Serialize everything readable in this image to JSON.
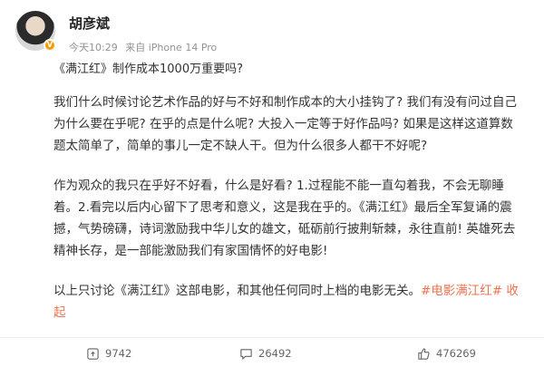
{
  "post": {
    "username": "胡彦斌",
    "time": "今天10:29",
    "source": "来自 iPhone 14 Pro",
    "title": "《满江红》制作成本1000万重要吗?",
    "paragraphs": [
      "我们什么时候讨论艺术作品的好与不好和制作成本的大小挂钩了? 我们有没有问过自己为什么要在乎呢? 在乎的点是什么呢? 大投入一定等于好作品吗? 如果是这样这道算数题太简单了，简单的事儿一定不缺人干。但为什么很多人都干不好呢?",
      "作为观众的我只在乎好不好看，什么是好看? 1.过程能不能一直勾着我，不会无聊睡着。2.看完以后内心留下了思考和意义，这是我在乎的。《满江红》最后全军复诵的震撼，气势磅礴，诗词激励我中华儿女的雄文，砥砺前行披荆斩棘，永往直前! 英雄死去精神长存，是一部能激励我们有家国情怀的好电影!"
    ],
    "last_text": "以上只讨论《满江红》这部电影，和其他任何同时上档的电影无关。",
    "tag": "#电影满江红#",
    "collapse_label": "收起"
  },
  "actions": {
    "repost_count": "9742",
    "comment_count": "26492",
    "like_count": "476269"
  },
  "colors": {
    "accent": "#eb7350",
    "badge": "#f59b00",
    "meta": "#939393"
  },
  "icons": [
    "repost-icon",
    "comment-icon",
    "like-icon",
    "verified-badge-icon"
  ]
}
